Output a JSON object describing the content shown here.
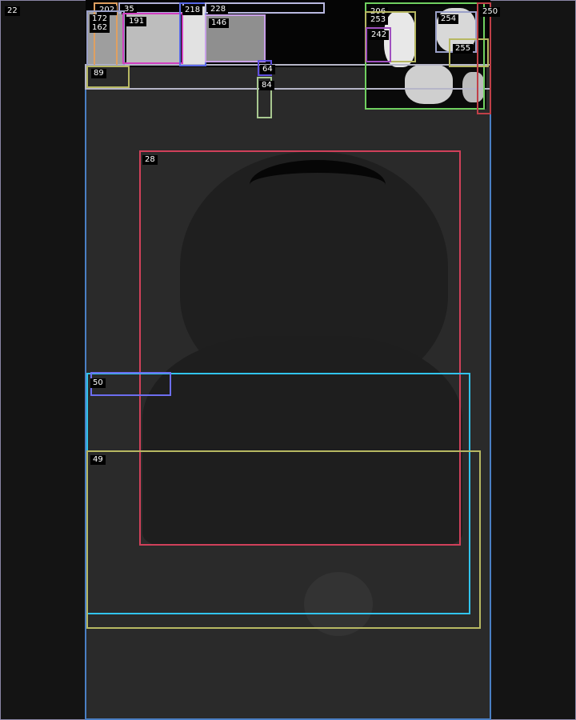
{
  "labels": {
    "l22": "22",
    "l202": "202",
    "l35": "35",
    "l172": "172",
    "l162": "162",
    "l191": "191",
    "l218": "218",
    "l228": "228",
    "l146": "146",
    "l64": "64",
    "l84": "84",
    "l89": "89",
    "l206": "206",
    "l253": "253",
    "l242": "242",
    "l254": "254",
    "l255": "255",
    "l250": "250",
    "l28": "28",
    "l50": "50",
    "l49": "49"
  },
  "colors": {
    "background": "#141414",
    "center_column": "#2a2a2a",
    "outline_page": "#8a86a6",
    "outline_main": "#4a7fc4",
    "outline_face": "#d0405a",
    "outline_cyan": "#31c4ee",
    "outline_olive": "#b7b862",
    "outline_violet": "#6d6ef0",
    "outline_green": "#70d060"
  }
}
